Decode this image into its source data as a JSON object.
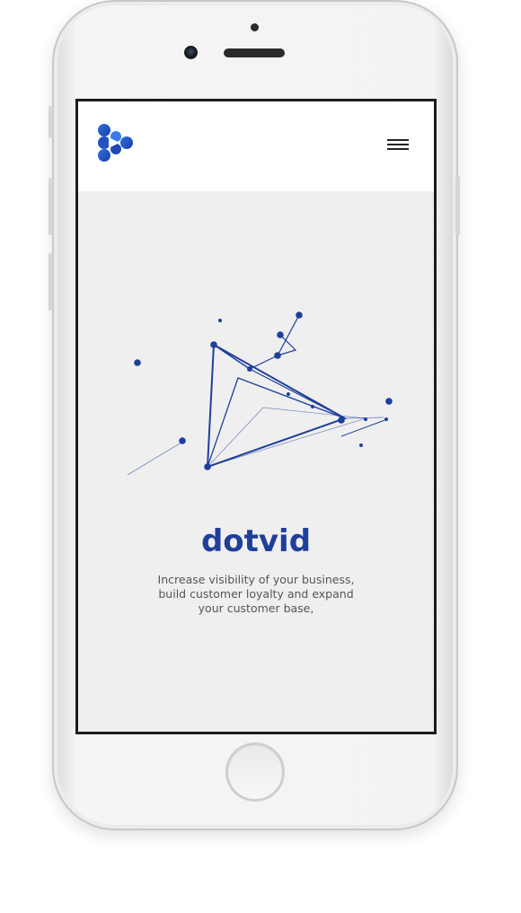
{
  "device": {
    "type": "smartphone",
    "icons": [
      "front-camera-icon",
      "speaker-grille-icon",
      "home-button-icon"
    ]
  },
  "header": {
    "logo_icon": "dotvid-logo-icon",
    "menu_icon": "hamburger-menu-icon"
  },
  "hero": {
    "graphic_icon": "network-triangle-illustration",
    "title": "dotvid",
    "tagline_lines": [
      "Increase visibility of your business,",
      "build customer loyalty and expand",
      "your customer base,"
    ]
  },
  "colors": {
    "brand_blue": "#1f3f9b",
    "screen_bg": "#efefef",
    "header_bg": "#ffffff",
    "text_gray": "#555555"
  }
}
